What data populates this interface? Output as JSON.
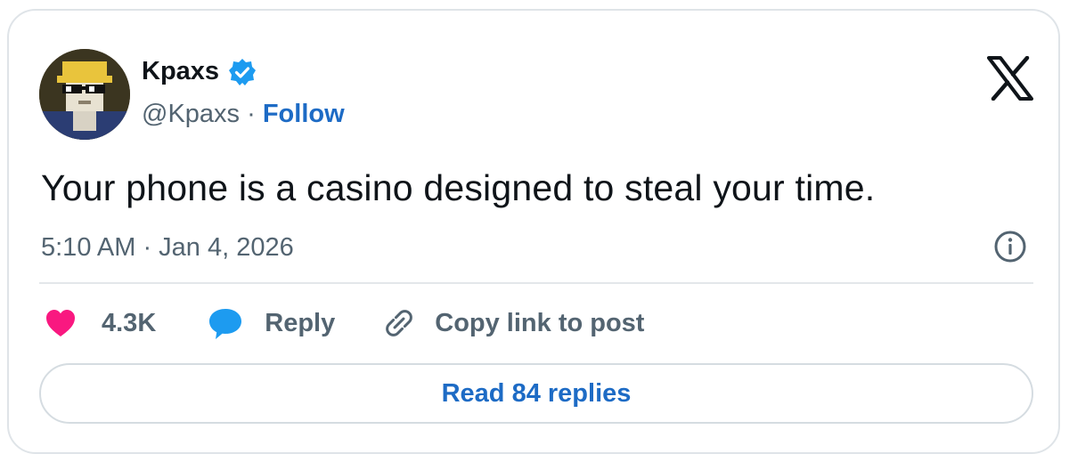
{
  "author": {
    "name": "Kpaxs",
    "handle": "@Kpaxs",
    "separator": " · ",
    "follow_label": "Follow"
  },
  "post": {
    "text": "Your phone is a casino designed to steal your time.",
    "timestamp": "5:10 AM · Jan 4, 2026"
  },
  "actions": {
    "likes_count": "4.3K",
    "reply_label": "Reply",
    "copy_link_label": "Copy link to post"
  },
  "replies_button": {
    "label": "Read 84 replies"
  },
  "icons": {
    "verified": "verified-badge-icon",
    "brand": "x-logo-icon",
    "info": "info-icon",
    "like": "heart-icon",
    "reply": "speech-bubble-icon",
    "link": "link-icon"
  },
  "colors": {
    "link_blue": "#1d6bc5",
    "verified_blue": "#1d9bf0",
    "heart_pink": "#f91880",
    "reply_blue": "#1d9bf0",
    "text_primary": "#0f1419",
    "text_secondary": "#536471"
  }
}
